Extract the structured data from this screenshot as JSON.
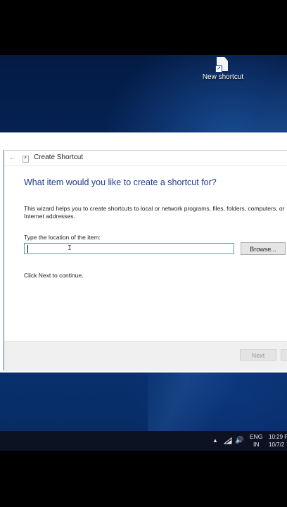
{
  "desktop": {
    "icon_label": "New shortcut",
    "shortcut_arrow": "↗"
  },
  "dialog": {
    "title": "Create Shortcut",
    "back_glyph": "←",
    "heading": "What item would you like to create a shortcut for?",
    "description": "This wizard helps you to create shortcuts to local or network programs, files, folders, computers, or Internet addresses.",
    "location_label": "Type the location of the item:",
    "location_value": "",
    "browse_label": "Browse...",
    "hint": "Click Next to continue.",
    "next_label": "Next"
  },
  "taskbar": {
    "chevron": "▲",
    "volume": "🔊",
    "lang_line1": "ENG",
    "lang_line2": "IN",
    "time": "10:29 P",
    "date": "10/7/2"
  }
}
